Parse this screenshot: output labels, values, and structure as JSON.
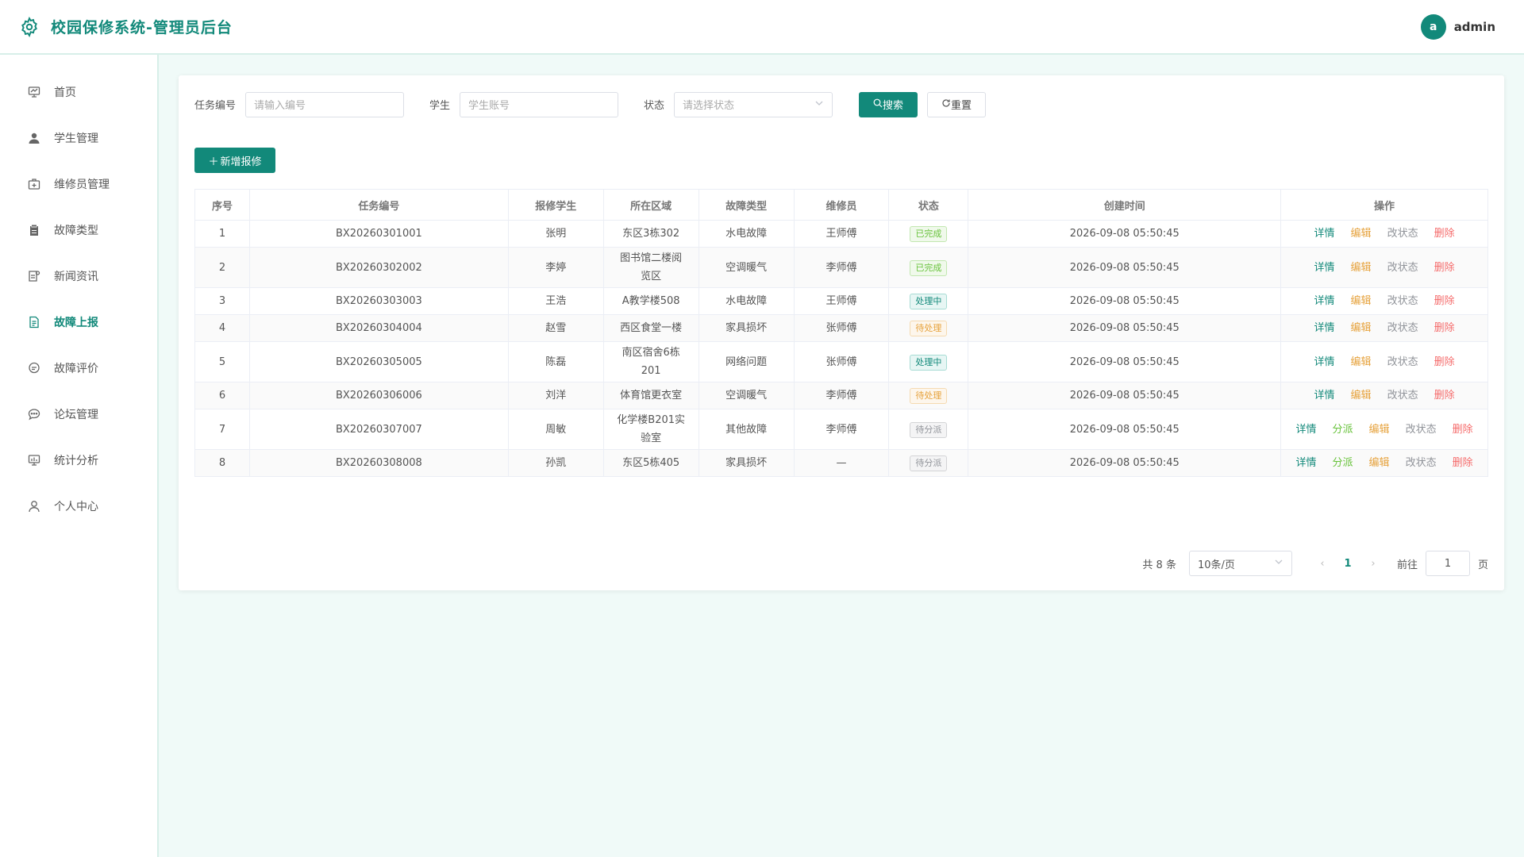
{
  "app": {
    "title": "校园保修系统-管理员后台",
    "logo_icon": "gear-icon",
    "accent": "#12897a"
  },
  "user": {
    "avatar_letter": "a",
    "name": "admin"
  },
  "sidebar": {
    "items": [
      {
        "label": "首页",
        "icon": "dashboard-icon"
      },
      {
        "label": "学生管理",
        "icon": "user-icon"
      },
      {
        "label": "维修员管理",
        "icon": "toolbox-icon"
      },
      {
        "label": "故障类型",
        "icon": "clipboard-icon"
      },
      {
        "label": "新闻资讯",
        "icon": "news-icon"
      },
      {
        "label": "故障上报",
        "icon": "document-icon",
        "active": true
      },
      {
        "label": "故障评价",
        "icon": "comment-icon"
      },
      {
        "label": "论坛管理",
        "icon": "chat-icon"
      },
      {
        "label": "统计分析",
        "icon": "chart-icon"
      },
      {
        "label": "个人中心",
        "icon": "person-icon"
      }
    ]
  },
  "filters": {
    "task_label": "任务编号",
    "task_placeholder": "请输入编号",
    "student_label": "学生",
    "student_placeholder": "学生账号",
    "status_label": "状态",
    "status_placeholder": "请选择状态",
    "search_label": "搜索",
    "reset_label": "重置"
  },
  "add_button": "新增报修",
  "table": {
    "headers": [
      "序号",
      "任务编号",
      "报修学生",
      "所在区域",
      "故障类型",
      "维修员",
      "状态",
      "创建时间",
      "操作"
    ],
    "rows": [
      {
        "no": "1",
        "code": "BX20260301001",
        "student": "张明",
        "area": "东区3栋302",
        "type": "水电故障",
        "worker": "王师傅",
        "status": "已完成",
        "created": "2026-09-08 05:50:45"
      },
      {
        "no": "2",
        "code": "BX20260302002",
        "student": "李婷",
        "area": "图书馆二楼阅览区",
        "type": "空调暖气",
        "worker": "李师傅",
        "status": "已完成",
        "created": "2026-09-08 05:50:45"
      },
      {
        "no": "3",
        "code": "BX20260303003",
        "student": "王浩",
        "area": "A教学楼508",
        "type": "水电故障",
        "worker": "王师傅",
        "status": "处理中",
        "created": "2026-09-08 05:50:45"
      },
      {
        "no": "4",
        "code": "BX20260304004",
        "student": "赵雪",
        "area": "西区食堂一楼",
        "type": "家具损坏",
        "worker": "张师傅",
        "status": "待处理",
        "created": "2026-09-08 05:50:45"
      },
      {
        "no": "5",
        "code": "BX20260305005",
        "student": "陈磊",
        "area": "南区宿舍6栋201",
        "type": "网络问题",
        "worker": "张师傅",
        "status": "处理中",
        "created": "2026-09-08 05:50:45"
      },
      {
        "no": "6",
        "code": "BX20260306006",
        "student": "刘洋",
        "area": "体育馆更衣室",
        "type": "空调暖气",
        "worker": "李师傅",
        "status": "待处理",
        "created": "2026-09-08 05:50:45"
      },
      {
        "no": "7",
        "code": "BX20260307007",
        "student": "周敏",
        "area": "化学楼B201实验室",
        "type": "其他故障",
        "worker": "李师傅",
        "status": "待分派",
        "created": "2026-09-08 05:50:45"
      },
      {
        "no": "8",
        "code": "BX20260308008",
        "student": "孙凯",
        "area": "东区5栋405",
        "type": "家具损坏",
        "worker": "—",
        "status": "待分派",
        "created": "2026-09-08 05:50:45"
      }
    ],
    "ops": {
      "detail": "详情",
      "assign": "分派",
      "edit": "编辑",
      "change_status": "改状态",
      "delete": "删除"
    },
    "status_colors": {
      "已完成": {
        "text": "#67c23a",
        "bg": "#f0f9eb",
        "border": "#c2e7b0"
      },
      "处理中": {
        "text": "#12897a",
        "bg": "#e7f6f4",
        "border": "#a7dcd4"
      },
      "待处理": {
        "text": "#e6a23c",
        "bg": "#fdf6ec",
        "border": "#f5dab1"
      },
      "待分派": {
        "text": "#909399",
        "bg": "#f4f4f5",
        "border": "#d3d4d6"
      }
    }
  },
  "pagination": {
    "total": "共 8 条",
    "page_size": "10条/页",
    "current": "1",
    "goto_label": "前往",
    "goto_value": "1",
    "page_suffix": "页"
  }
}
